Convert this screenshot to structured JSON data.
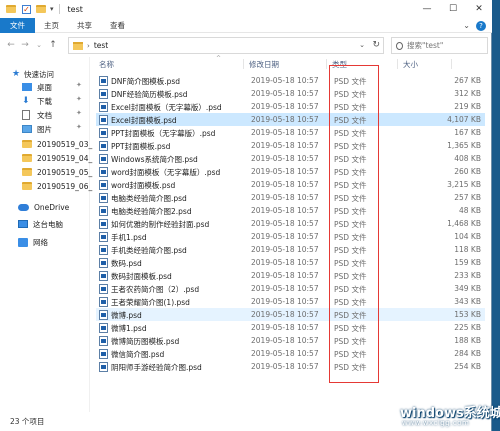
{
  "window": {
    "title": "test"
  },
  "ribbon": {
    "tabs": [
      "文件",
      "主页",
      "共享",
      "查看"
    ]
  },
  "address": {
    "path": "test"
  },
  "search": {
    "placeholder": "搜索\"test\""
  },
  "sidebar": {
    "quick_access": "快速访问",
    "items": [
      "桌面",
      "下载",
      "文档",
      "图片",
      "20190519_03_",
      "20190519_04_",
      "20190519_05_",
      "20190519_06_"
    ],
    "onedrive": "OneDrive",
    "this_pc": "这台电脑",
    "network": "网络"
  },
  "columns": {
    "name": "名称",
    "date": "修改日期",
    "type": "类型",
    "size": "大小"
  },
  "files": [
    {
      "name": "DNF简介图模板.psd",
      "date": "2019-05-18 10:57",
      "type": "PSD 文件",
      "size": "267 KB"
    },
    {
      "name": "DNF经验简历模板.psd",
      "date": "2019-05-18 10:57",
      "type": "PSD 文件",
      "size": "312 KB"
    },
    {
      "name": "Excel封面模板（无字幕版）.psd",
      "date": "2019-05-18 10:57",
      "type": "PSD 文件",
      "size": "219 KB"
    },
    {
      "name": "Excel封面模板.psd",
      "date": "2019-05-18 10:57",
      "type": "PSD 文件",
      "size": "4,107 KB"
    },
    {
      "name": "PPT封面模板（无字幕版）.psd",
      "date": "2019-05-18 10:57",
      "type": "PSD 文件",
      "size": "167 KB"
    },
    {
      "name": "PPT封面模板.psd",
      "date": "2019-05-18 10:57",
      "type": "PSD 文件",
      "size": "1,365 KB"
    },
    {
      "name": "Windows系统简介图.psd",
      "date": "2019-05-18 10:57",
      "type": "PSD 文件",
      "size": "408 KB"
    },
    {
      "name": "word封面模板（无字幕版）.psd",
      "date": "2019-05-18 10:57",
      "type": "PSD 文件",
      "size": "260 KB"
    },
    {
      "name": "word封面模板.psd",
      "date": "2019-05-18 10:57",
      "type": "PSD 文件",
      "size": "3,215 KB"
    },
    {
      "name": "电脑类经验简介图.psd",
      "date": "2019-05-18 10:57",
      "type": "PSD 文件",
      "size": "257 KB"
    },
    {
      "name": "电脑类经验简介图2.psd",
      "date": "2019-05-18 10:57",
      "type": "PSD 文件",
      "size": "48 KB"
    },
    {
      "name": "如何优雅的制作经验封面.psd",
      "date": "2019-05-18 10:57",
      "type": "PSD 文件",
      "size": "1,468 KB"
    },
    {
      "name": "手机1.psd",
      "date": "2019-05-18 10:57",
      "type": "PSD 文件",
      "size": "104 KB"
    },
    {
      "name": "手机类经验简介图.psd",
      "date": "2019-05-18 10:57",
      "type": "PSD 文件",
      "size": "118 KB"
    },
    {
      "name": "数码.psd",
      "date": "2019-05-18 10:57",
      "type": "PSD 文件",
      "size": "159 KB"
    },
    {
      "name": "数码封面模板.psd",
      "date": "2019-05-18 10:57",
      "type": "PSD 文件",
      "size": "233 KB"
    },
    {
      "name": "王者农药简介图（2）.psd",
      "date": "2019-05-18 10:57",
      "type": "PSD 文件",
      "size": "349 KB"
    },
    {
      "name": "王者荣耀简介图(1).psd",
      "date": "2019-05-18 10:57",
      "type": "PSD 文件",
      "size": "343 KB"
    },
    {
      "name": "微博.psd",
      "date": "2019-05-18 10:57",
      "type": "PSD 文件",
      "size": "153 KB"
    },
    {
      "name": "微博1.psd",
      "date": "2019-05-18 10:57",
      "type": "PSD 文件",
      "size": "225 KB"
    },
    {
      "name": "微博简历图模板.psd",
      "date": "2019-05-18 10:57",
      "type": "PSD 文件",
      "size": "188 KB"
    },
    {
      "name": "微信简介图.psd",
      "date": "2019-05-18 10:57",
      "type": "PSD 文件",
      "size": "284 KB"
    },
    {
      "name": "阴阳师手游经验简介图.psd",
      "date": "2019-05-18 10:57",
      "type": "PSD 文件",
      "size": "254 KB"
    }
  ],
  "selected_file_index": 3,
  "hovered_file_index": 18,
  "status": {
    "count": "23 个项目"
  },
  "watermark": {
    "main": "windows系统城",
    "sub": "www.wxclgg.com"
  },
  "colors": {
    "accent": "#1979ca",
    "selected": "#cce8ff",
    "annotation": "#e53935"
  }
}
